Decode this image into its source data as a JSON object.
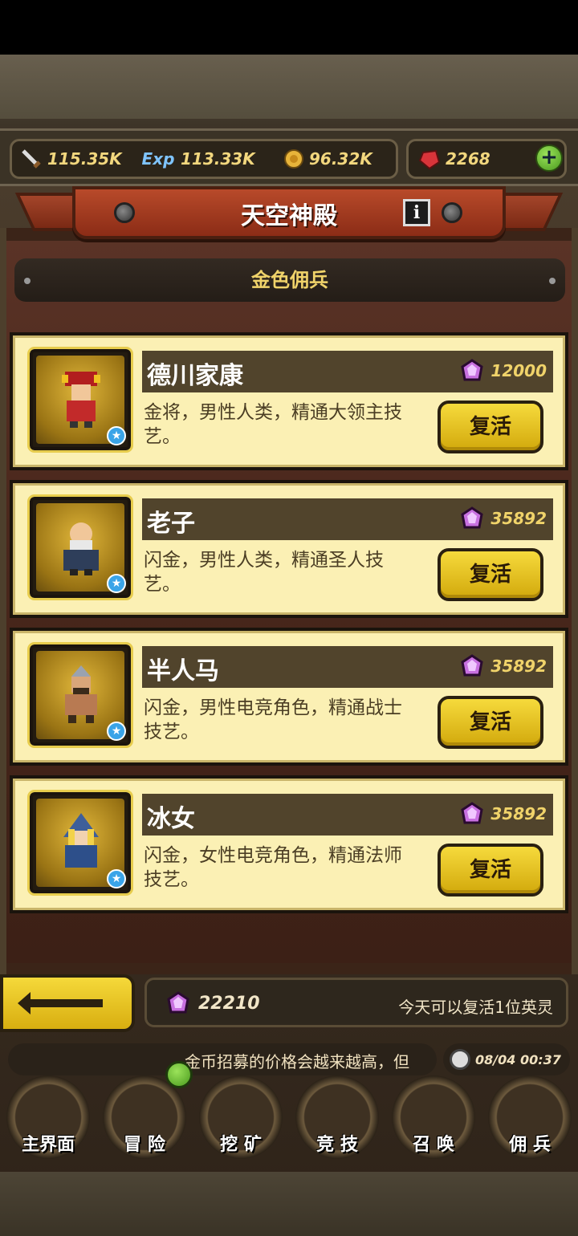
{
  "resources": {
    "attack": "115.35K",
    "exp_icon_text": "Exp",
    "exp": "113.33K",
    "gold": "96.32K",
    "gems": "2268",
    "add_symbol": "+"
  },
  "header": {
    "title": "天空神殿",
    "info_symbol": "i"
  },
  "subtitle": "金色佣兵",
  "heroes": [
    {
      "name": "德川家康",
      "price": "12000",
      "desc": "金将，男性人类，精通大领主技艺。",
      "button": "复活"
    },
    {
      "name": "老子",
      "price": "35892",
      "desc": "闪金，男性人类，精通圣人技艺。",
      "button": "复活"
    },
    {
      "name": "半人马",
      "price": "35892",
      "desc": "闪金，男性电竞角色，精通战士技艺。",
      "button": "复活"
    },
    {
      "name": "冰女",
      "price": "35892",
      "desc": "闪金，女性电竞角色，精通法师技艺。",
      "button": "复活"
    }
  ],
  "footer": {
    "gems": "22210",
    "note": "今天可以复活1位英灵"
  },
  "ticker": "金币招募的价格会越来越高，但",
  "clock": "08/04 00:37",
  "nav": [
    "主界面",
    "冒 险",
    "挖 矿",
    "竞 技",
    "召 唤",
    "佣 兵"
  ],
  "colors": {
    "gold_text": "#f0d36a",
    "card_bg": "#fbf0b4",
    "button_yellow": "#f6da3c",
    "banner_red": "#b84a2a"
  }
}
